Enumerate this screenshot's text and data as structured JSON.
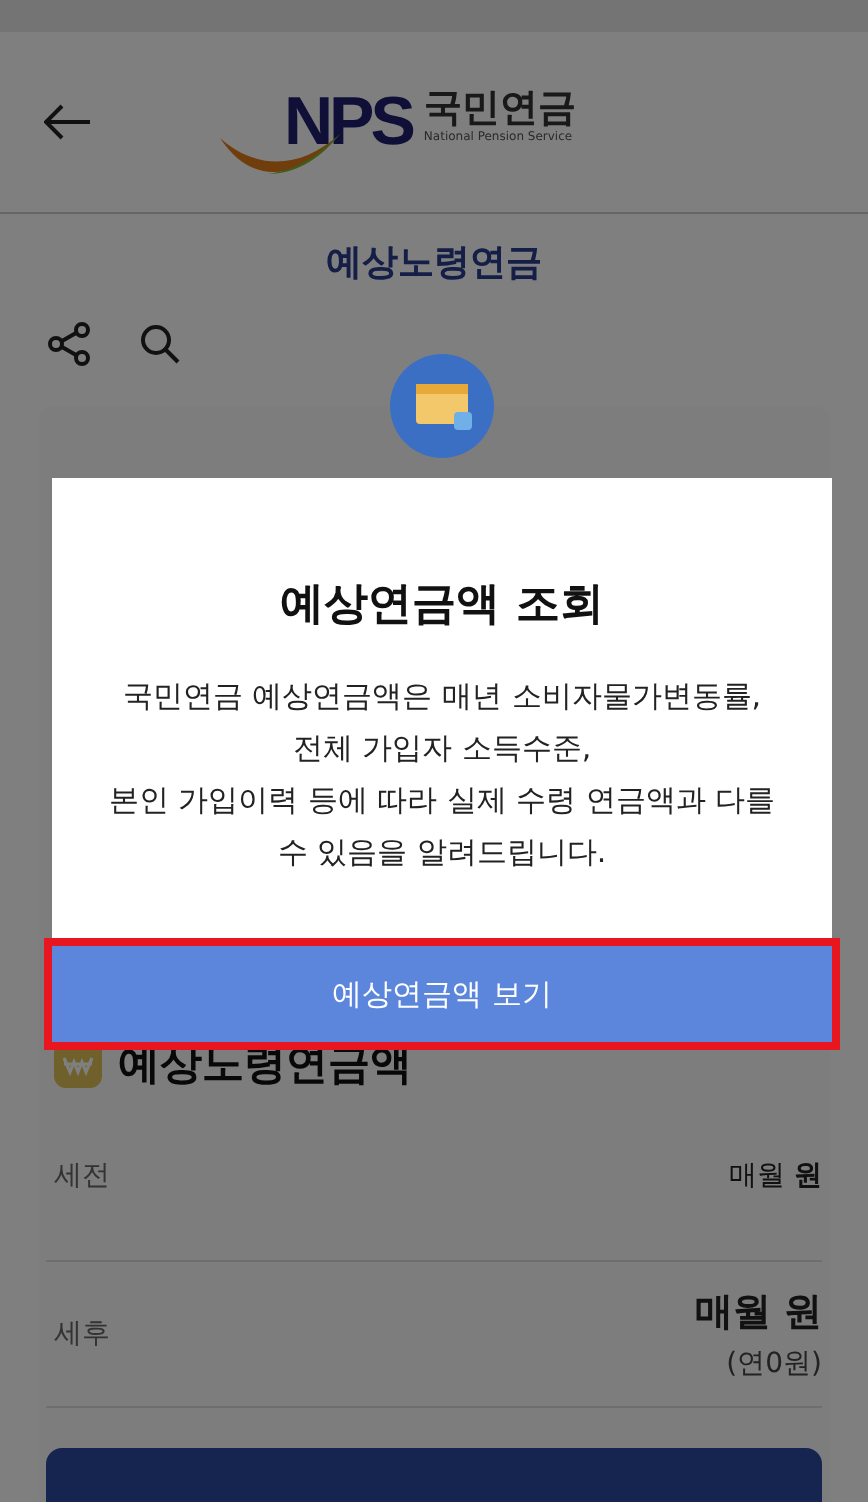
{
  "header": {
    "logo": {
      "mark": "NPS",
      "name": "국민연금",
      "subtitle": "National Pension Service"
    }
  },
  "page_title": "예상노령연금",
  "section": {
    "title": "예상노령연금액",
    "rows": [
      {
        "label": "세전",
        "value": "매월 **원**",
        "emphasis": false
      },
      {
        "label": "세후",
        "value": "매월 원",
        "emphasis": true,
        "note": "(연0원)"
      }
    ]
  },
  "modal": {
    "title": "예상연금액 조회",
    "message": "국민연금 예상연금액은 매년 소비자물가변동률, 전체 가입자 소득수준,\n본인 가입이력 등에 따라 실제 수령 연금액과 다를 수 있음을 알려드립니다.",
    "button": "예상연금액 보기",
    "highlighted": true
  }
}
